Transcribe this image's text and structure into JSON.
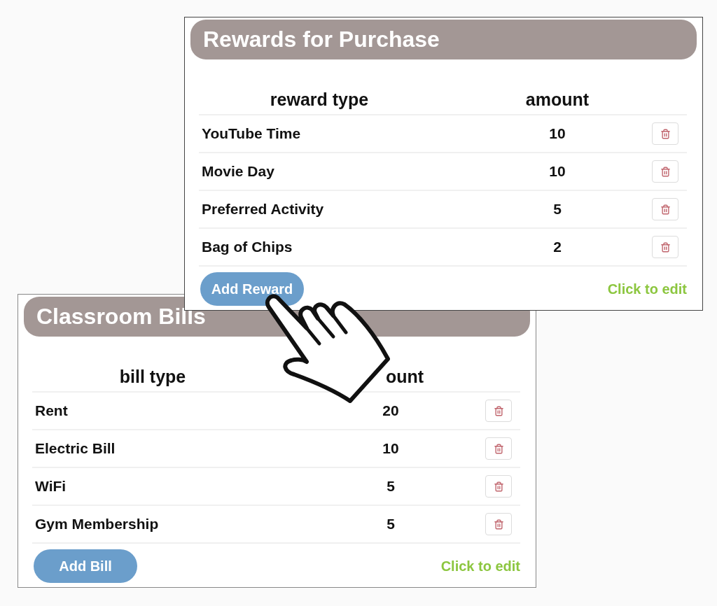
{
  "panels": [
    {
      "title": "Rewards for Purchase",
      "columns": [
        "reward type",
        "amount"
      ],
      "rows": [
        {
          "name": "YouTube Time",
          "amount": "10"
        },
        {
          "name": "Movie Day",
          "amount": "10"
        },
        {
          "name": "Preferred Activity",
          "amount": "5"
        },
        {
          "name": "Bag of Chips",
          "amount": "2"
        }
      ],
      "add_button": "Add Reward",
      "edit_link": "Click to edit"
    },
    {
      "title": "Classroom Bills",
      "columns": [
        "bill type",
        "ount"
      ],
      "rows": [
        {
          "name": "Rent",
          "amount": "20"
        },
        {
          "name": "Electric Bill",
          "amount": "10"
        },
        {
          "name": "WiFi",
          "amount": "5"
        },
        {
          "name": "Gym Membership",
          "amount": "5"
        }
      ],
      "add_button": "Add Bill",
      "edit_link": "Click to edit"
    }
  ]
}
